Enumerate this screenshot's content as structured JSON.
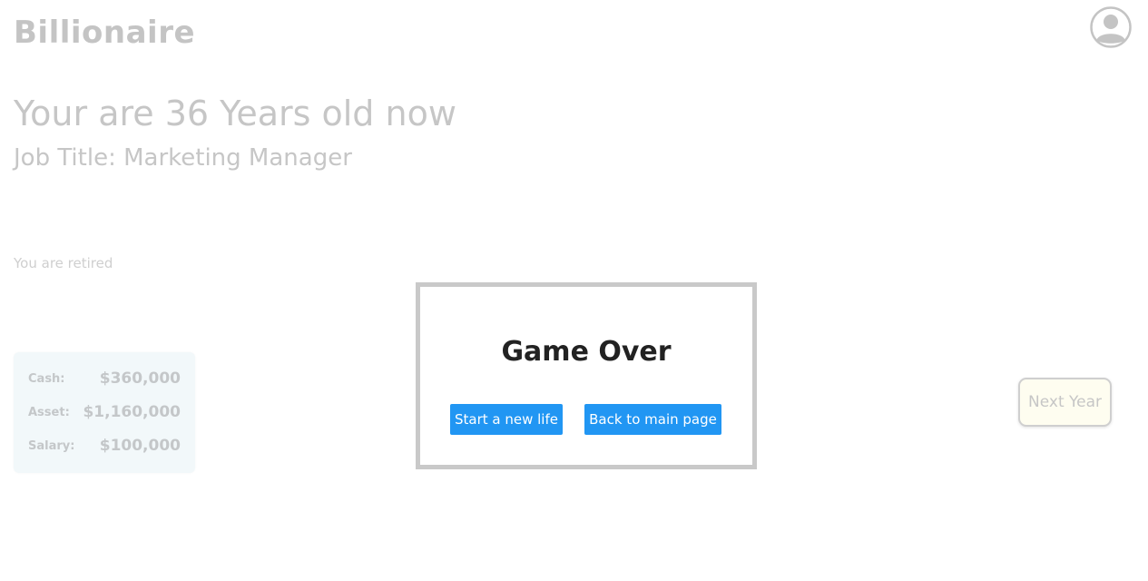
{
  "header": {
    "logo": "Billionaire",
    "avatar_icon": "user-circle-icon"
  },
  "player": {
    "age_line": "Your are 36 Years old now",
    "job_line": "Job Title: Marketing Manager",
    "status": "You are retired"
  },
  "stats": {
    "cash_label": "Cash:",
    "cash_value": "$360,000",
    "asset_label": "Asset:",
    "asset_value": "$1,160,000",
    "salary_label": "Salary:",
    "salary_value": "$100,000"
  },
  "actions": {
    "next_year": "Next Year"
  },
  "modal": {
    "title": "Game Over",
    "new_life_button": "Start a new life",
    "main_page_button": "Back to main page"
  },
  "colors": {
    "primary_button": "#2196f3",
    "faded_text": "#c6c6c6",
    "stats_card_bg": "#f2f8fa",
    "next_year_bg": "#fefdf0"
  }
}
